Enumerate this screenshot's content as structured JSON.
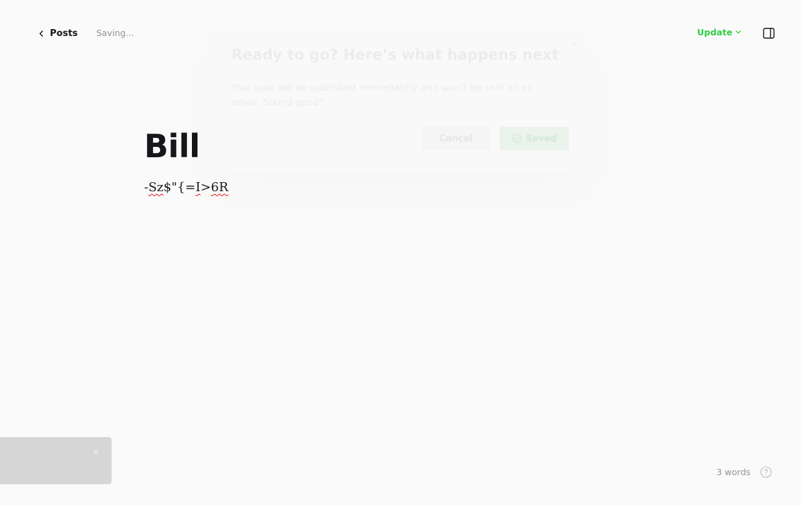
{
  "header": {
    "back_label": "Posts",
    "status": "Saving...",
    "update_label": "Update"
  },
  "editor": {
    "title": "Bill",
    "body_parts": [
      "-",
      "Sz",
      "$\"{=",
      "I",
      ">",
      "6R"
    ]
  },
  "modal": {
    "close_glyph": "×",
    "title": "Ready to go? Here’s what happens next",
    "body": "Your post will be published immediately and won’t be sent as an email. Sound good?",
    "cancel_label": "Cancel",
    "confirm_label": "Saved"
  },
  "toast": {
    "close_glyph": "×"
  },
  "footer": {
    "word_count": "3 words"
  },
  "colors": {
    "accent": "#30cf43",
    "text": "#15171a",
    "muted": "#8e9499"
  },
  "icons": {
    "back": "chevron-left-icon",
    "update": "chevron-down-icon",
    "sidebar": "sidebar-toggle-icon",
    "saved": "check-circle-icon",
    "help": "question-circle-icon"
  }
}
